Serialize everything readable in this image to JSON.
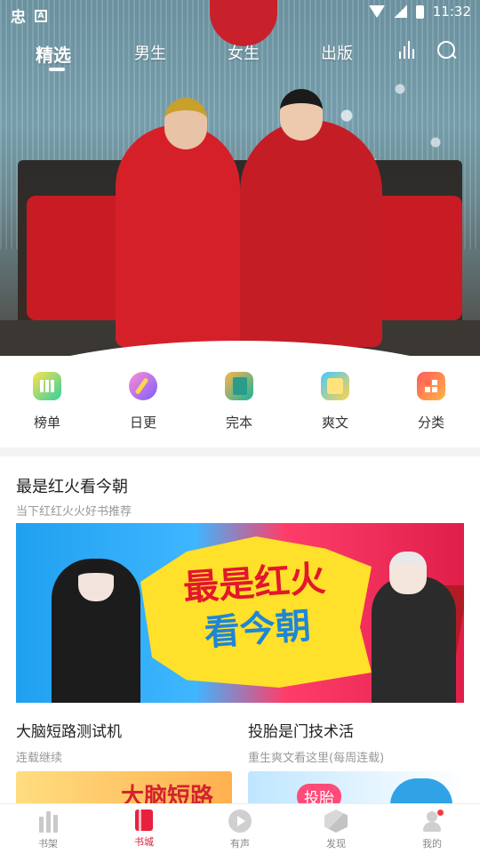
{
  "status_bar": {
    "app_glyph": "忠",
    "notification_glyph": "A",
    "time": "11:32"
  },
  "top_tabs": [
    {
      "label": "精选",
      "active": true
    },
    {
      "label": "男生",
      "active": false
    },
    {
      "label": "女生",
      "active": false
    },
    {
      "label": "出版",
      "active": false
    }
  ],
  "top_icons": {
    "rank": "bar-chart-icon",
    "search": "search-icon"
  },
  "carousel": {
    "page_count": 4,
    "active_index": 0
  },
  "quick_menu": [
    {
      "label": "榜单",
      "icon": "ranking-icon"
    },
    {
      "label": "日更",
      "icon": "pen-icon"
    },
    {
      "label": "完本",
      "icon": "book-icon"
    },
    {
      "label": "爽文",
      "icon": "open-book-icon"
    },
    {
      "label": "分类",
      "icon": "category-icon"
    }
  ],
  "featured": {
    "title": "最是红火看今朝",
    "subtitle": "当下红红火火好书推荐",
    "banner_line1": "最是红火",
    "banner_line2": "看今朝"
  },
  "books": [
    {
      "title": "大脑短路测试机",
      "subtitle": "连载继续",
      "cover_text": "大脑短路"
    },
    {
      "title": "投胎是门技术活",
      "subtitle": "重生爽文看这里(每周连载)",
      "cover_text": "投胎"
    }
  ],
  "bottom_nav": [
    {
      "label": "书架",
      "icon": "bookshelf-icon",
      "active": false
    },
    {
      "label": "书城",
      "icon": "bookstore-icon",
      "active": true
    },
    {
      "label": "有声",
      "icon": "play-icon",
      "active": false
    },
    {
      "label": "发现",
      "icon": "cube-icon",
      "active": false
    },
    {
      "label": "我的",
      "icon": "user-icon",
      "active": false
    }
  ],
  "colors": {
    "accent": "#d9213a",
    "muted_text": "#999999"
  }
}
